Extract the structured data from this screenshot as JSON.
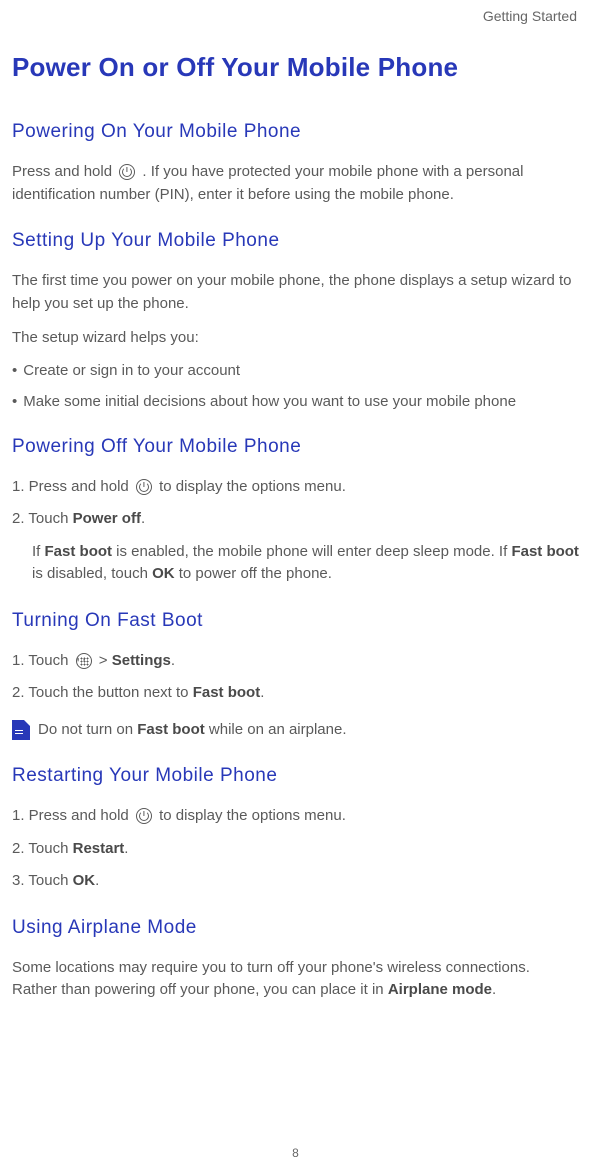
{
  "header": "Getting Started",
  "title": "Power On or Off Your Mobile Phone",
  "s1": {
    "heading": "Powering On Your Mobile Phone",
    "p1a": "Press and hold ",
    "p1b": " . If you have protected your mobile phone with a personal identification number (PIN), enter it before using the mobile phone."
  },
  "s2": {
    "heading": "Setting Up Your Mobile Phone",
    "p1": "The first time you power on your mobile phone, the phone displays a setup wizard to help you set up the phone.",
    "p2": "The setup wizard helps you:",
    "b1": "Create or sign in to your account",
    "b2": "Make some initial decisions about how you want to use your mobile phone"
  },
  "s3": {
    "heading": "Powering Off Your Mobile Phone",
    "n1a": "1. Press and hold ",
    "n1b": " to display the options menu.",
    "n2a": "2. Touch ",
    "n2b": "Power off",
    "n2c": ".",
    "indenta": "If ",
    "indentb": "Fast boot",
    "indentc": " is enabled, the mobile phone will enter deep sleep mode. If ",
    "indentd": "Fast boot",
    "indente": " is disabled, touch ",
    "indentf": "OK",
    "indentg": " to power off the phone."
  },
  "s4": {
    "heading": "Turning On Fast Boot",
    "n1a": "1. Touch ",
    "n1b": " > ",
    "n1c": "Settings",
    "n1d": ".",
    "n2a": "2. Touch the button next to ",
    "n2b": "Fast boot",
    "n2c": ".",
    "notea": "Do not turn on ",
    "noteb": "Fast boot",
    "notec": " while on an airplane."
  },
  "s5": {
    "heading": "Restarting Your Mobile Phone",
    "n1a": "1. Press and hold ",
    "n1b": " to display the options menu.",
    "n2a": "2. Touch ",
    "n2b": "Restart",
    "n2c": ".",
    "n3a": "3. Touch ",
    "n3b": "OK",
    "n3c": "."
  },
  "s6": {
    "heading": "Using Airplane Mode",
    "p1a": "Some locations may require you to turn off your phone's wireless connections. Rather than powering off your phone, you can place it in ",
    "p1b": "Airplane mode",
    "p1c": "."
  },
  "pageNumber": "8"
}
